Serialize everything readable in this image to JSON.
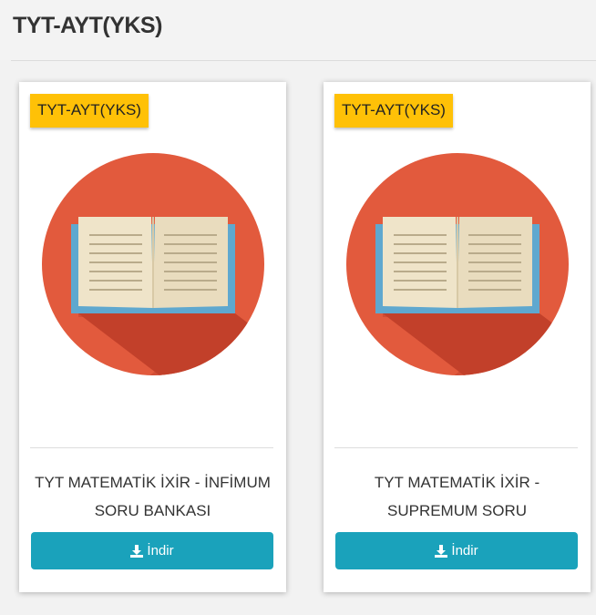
{
  "header": {
    "title": "TYT-AYT(YKS)"
  },
  "cards": [
    {
      "badge": "TYT-AYT(YKS)",
      "title": "TYT MATEMATİK İXİR - İNFİMUM SORU BANKASI",
      "button_label": "İndir",
      "icon": "book-icon"
    },
    {
      "badge": "TYT-AYT(YKS)",
      "title": "TYT MATEMATİK İXİR - SUPREMUM SORU",
      "button_label": "İndir",
      "icon": "book-icon"
    }
  ],
  "colors": {
    "badge_bg": "#ffc107",
    "button_bg": "#1aa2bb",
    "cover_circle": "#e25a3d",
    "cover_shadow": "#c2402a",
    "book_spine": "#5fa8cf",
    "book_pages": "#efe4c9"
  }
}
